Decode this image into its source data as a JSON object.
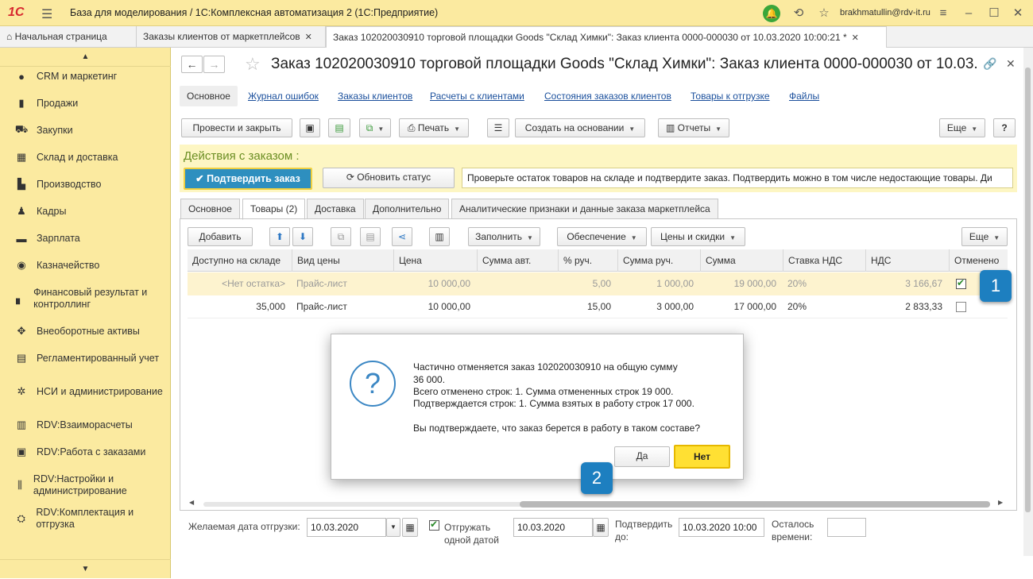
{
  "titlebar": {
    "logo": "1С",
    "title": "База для моделирования / 1С:Комплексная автоматизация 2  (1С:Предприятие)",
    "user": "brakhmatullin@rdv-it.ru"
  },
  "tabs": [
    {
      "label": "Начальная страница"
    },
    {
      "label": "Заказы клиентов от маркетплейсов"
    },
    {
      "label": "Заказ 102020030910 торговой площадки Goods \"Склад Химки\": Заказ клиента 0000-000030 от 10.03.2020 10:00:21 *"
    }
  ],
  "sidebar": {
    "items": [
      {
        "icon": "●",
        "label": "CRM и маркетинг"
      },
      {
        "icon": "▮",
        "label": "Продажи"
      },
      {
        "icon": "⛟",
        "label": "Закупки"
      },
      {
        "icon": "▦",
        "label": "Склад и доставка"
      },
      {
        "icon": "▙",
        "label": "Производство"
      },
      {
        "icon": "♟",
        "label": "Кадры"
      },
      {
        "icon": "▬",
        "label": "Зарплата"
      },
      {
        "icon": "◉",
        "label": "Казначейство"
      },
      {
        "icon": "▖",
        "label": "Финансовый результат и контроллинг"
      },
      {
        "icon": "✥",
        "label": "Внеоборотные активы"
      },
      {
        "icon": "▤",
        "label": "Регламентированный учет"
      },
      {
        "icon": "✲",
        "label": "НСИ и администрирование"
      },
      {
        "icon": "▥",
        "label": "RDV:Взаиморасчеты"
      },
      {
        "icon": "▣",
        "label": "RDV:Работа с заказами"
      },
      {
        "icon": "⫼",
        "label": "RDV:Настройки и администрирование"
      },
      {
        "icon": "⛭",
        "label": "RDV:Комплектация и отгрузка"
      }
    ]
  },
  "form": {
    "title": "Заказ 102020030910 торговой площадки Goods \"Склад Химки\": Заказ клиента 0000-000030 от 10.03.2...",
    "sections": [
      "Основное",
      "Журнал ошибок",
      "Заказы клиентов",
      "Расчеты с клиентами",
      "Состояния заказов клиентов",
      "Товары к отгрузке",
      "Файлы"
    ],
    "toolbar": {
      "post_close": "Провести и закрыть",
      "print": "Печать",
      "create_based": "Создать на основании",
      "reports": "Отчеты",
      "more": "Еще",
      "help": "?"
    },
    "actions": {
      "title": "Действия с заказом :",
      "confirm": "Подтвердить заказ",
      "refresh": "Обновить статус",
      "hint": "Проверьте остаток товаров на складе и подтвердите заказ. Подтвердить можно в том числе недостающие товары. Ди"
    },
    "inner_tabs": [
      "Основное",
      "Товары (2)",
      "Доставка",
      "Дополнительно",
      "Аналитические признаки и данные заказа маркетплейса"
    ],
    "goods_toolbar": {
      "add": "Добавить",
      "fill": "Заполнить",
      "supply": "Обеспечение",
      "prices": "Цены и скидки",
      "more": "Еще"
    },
    "columns": [
      "Доступно на складе",
      "Вид цены",
      "Цена",
      "Сумма авт.",
      "% руч.",
      "Сумма руч.",
      "Сумма",
      "Ставка НДС",
      "НДС",
      "Отменено"
    ],
    "rows": [
      {
        "available": "<Нет остатка>",
        "price_type": "Прайс-лист",
        "price": "10 000,00",
        "sum_auto": "",
        "pct": "5,00",
        "sum_manual": "1 000,00",
        "sum": "19 000,00",
        "vat_rate": "20%",
        "vat": "3 166,67",
        "cancelled": true
      },
      {
        "available": "35,000",
        "price_type": "Прайс-лист",
        "price": "10 000,00",
        "sum_auto": "",
        "pct": "15,00",
        "sum_manual": "3 000,00",
        "sum": "17 000,00",
        "vat_rate": "20%",
        "vat": "2 833,33",
        "cancelled": false
      }
    ],
    "bottom": {
      "ship_date_label": "Желаемая дата отгрузки:",
      "ship_date": "10.03.2020",
      "ship_one_date": "Отгружать одной датой",
      "ship_one_date_checked": true,
      "date2": "10.03.2020",
      "confirm_until_label": "Подтвердить до:",
      "confirm_until": "10.03.2020 10:00",
      "time_left_label": "Осталось времени:",
      "time_left": ""
    }
  },
  "dialog": {
    "lines": [
      "Частично отменяется заказ 102020030910 на общую сумму",
      "36 000.",
      "Всего отменено строк: 1. Сумма отмененных строк 19 000.",
      "Подтверждается строк: 1. Сумма взятых в работу строк 17 000.",
      "",
      "Вы подтверждаете, что заказ берется в работу в таком составе?"
    ],
    "yes": "Да",
    "no": "Нет"
  },
  "badges": {
    "one": "1",
    "two": "2"
  },
  "colors": {
    "accent": "#2e8fbf",
    "titlebar": "#fbeaa0",
    "highlight": "#ffe033",
    "badge": "#1d7fc0"
  }
}
